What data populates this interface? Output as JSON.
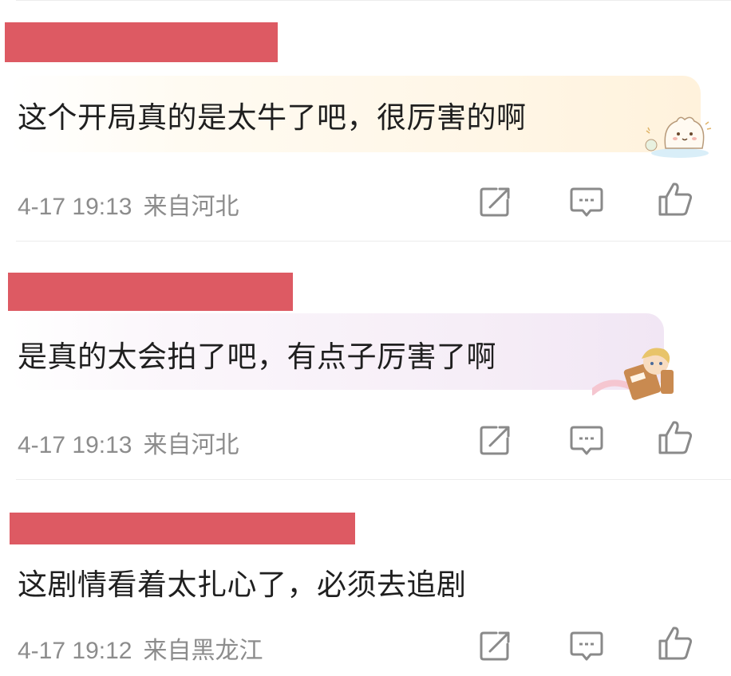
{
  "comments": [
    {
      "text": "这个开局真的是太牛了吧，很厉害的啊",
      "time": "4-17 19:13",
      "location": "来自河北"
    },
    {
      "text": "是真的太会拍了吧，有点子厉害了啊",
      "time": "4-17 19:13",
      "location": "来自河北"
    },
    {
      "text": "这剧情看着太扎心了，必须去追剧",
      "time": "4-17 19:12",
      "location": "来自黑龙江"
    }
  ],
  "icons": {
    "share": "share-icon",
    "comment": "comment-icon",
    "like": "thumbs-up-icon"
  },
  "colors": {
    "redaction": "#dd5a63",
    "meta_text": "#8c8c8c",
    "body_text": "#1f1f1f",
    "icon_stroke": "#8a8a8a"
  }
}
